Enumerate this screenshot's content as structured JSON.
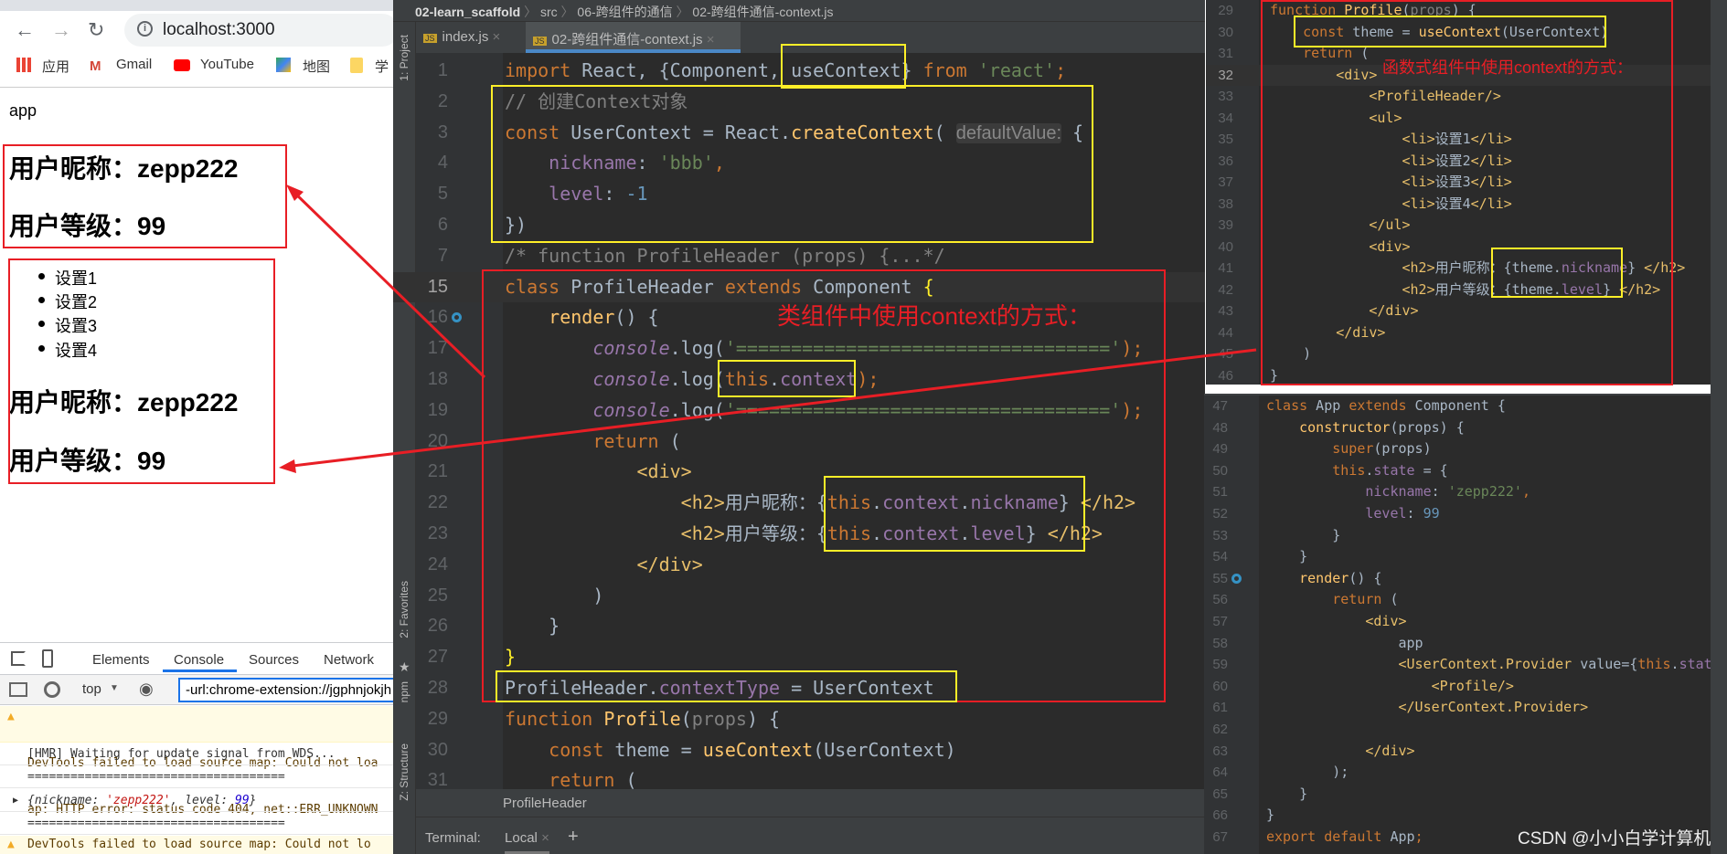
{
  "browser": {
    "address": "localhost:3000",
    "bookmarks": [
      "应用",
      "Gmail",
      "YouTube",
      "地图",
      "学"
    ],
    "page": {
      "app_text": "app",
      "top_h2": [
        "用户昵称：zepp222",
        "用户等级：99"
      ],
      "list": [
        "设置1",
        "设置2",
        "设置3",
        "设置4"
      ],
      "bottom_h2": [
        "用户昵称：zepp222",
        "用户等级：99"
      ]
    }
  },
  "devtools": {
    "tabs": [
      "Elements",
      "Console",
      "Sources",
      "Network"
    ],
    "active_tab": "Console",
    "context": "top",
    "filter": "-url:chrome-extension://jgphnjokjh",
    "messages": {
      "warn1_line1": "DevTools failed to load source map: Could not loa",
      "warn1_line2": "ap: HTTP error: status code 404, net::ERR_UNKNOWN",
      "hmr": "[HMR] Waiting for update signal from WDS...",
      "sep1": "====================================",
      "obj_open": "{nickname: ",
      "obj_nick": "'zepp222'",
      "obj_mid": ", level: ",
      "obj_level": "99",
      "obj_close": "}",
      "sep2": "====================================",
      "warn2": "DevTools failed to load source map: Could not lo"
    }
  },
  "ide": {
    "breadcrumb": [
      "02-learn_scaffold",
      "src",
      "06-跨组件的通信",
      "02-跨组件通信-context.js"
    ],
    "tabs": [
      "index.js",
      "02-跨组件通信-context.js"
    ],
    "tool_windows": [
      "1: Project",
      "2: Favorites",
      "npm",
      "Z: Structure"
    ],
    "structure_crumb": "ProfileHeader",
    "terminal_label": "Terminal:",
    "terminal_tab": "Local",
    "annotation_class": "类组件中使用context的方式：",
    "annotation_function": "函数式组件中使用context的方式：",
    "watermark": "CSDN @小小白学计算机",
    "colors": {
      "keyword": "#cc7832",
      "string": "#6a8759",
      "property": "#9876aa",
      "function": "#ffc66d",
      "annotation": "#e81e25",
      "highlight_box": "#ffef28"
    }
  },
  "editor": {
    "lines": [
      {
        "n": "1",
        "t": [
          [
            "import",
            "kw"
          ],
          [
            " React, {Component, useContext} ",
            "p"
          ],
          [
            "from",
            "kw"
          ],
          [
            " ",
            "p"
          ],
          [
            "'react'",
            "str"
          ],
          [
            ";",
            "kw"
          ]
        ]
      },
      {
        "n": "2",
        "t": [
          [
            "// 创建Context对象",
            "cm"
          ]
        ]
      },
      {
        "n": "3",
        "t": [
          [
            "const",
            "kw"
          ],
          [
            " UserContext = React.",
            "p"
          ],
          [
            "createContext",
            "fn"
          ],
          [
            "( ",
            "p"
          ],
          [
            "defaultValue:",
            "hint"
          ],
          [
            " {",
            "p"
          ]
        ]
      },
      {
        "n": "4",
        "t": [
          [
            "    ",
            "p"
          ],
          [
            "nickname",
            "prop"
          ],
          [
            ": ",
            "p"
          ],
          [
            "'bbb'",
            "str"
          ],
          [
            ",",
            "kw"
          ]
        ]
      },
      {
        "n": "5",
        "t": [
          [
            "    ",
            "p"
          ],
          [
            "level",
            "prop"
          ],
          [
            ": ",
            "p"
          ],
          [
            "-1",
            "num"
          ]
        ]
      },
      {
        "n": "6",
        "t": [
          [
            "})",
            "p"
          ]
        ]
      },
      {
        "n": "7",
        "t": [
          [
            "/* function ProfileHeader (props) {...*/",
            "cm"
          ]
        ]
      },
      {
        "n": "15",
        "t": [
          [
            "class",
            "kw"
          ],
          [
            " ProfileHeader ",
            "p"
          ],
          [
            "extends",
            "kw"
          ],
          [
            " Component ",
            "p"
          ],
          [
            "{",
            "yel"
          ]
        ]
      },
      {
        "n": "16",
        "t": [
          [
            "    ",
            "p"
          ],
          [
            "render",
            "fn"
          ],
          [
            "() {",
            "p"
          ]
        ]
      },
      {
        "n": "17",
        "t": [
          [
            "        ",
            "p"
          ],
          [
            "console",
            "it"
          ],
          [
            ".log(",
            "p"
          ],
          [
            "'=================================='",
            "str"
          ],
          [
            ");",
            "kw"
          ]
        ]
      },
      {
        "n": "18",
        "t": [
          [
            "        ",
            "p"
          ],
          [
            "console",
            "it"
          ],
          [
            ".log(",
            "p"
          ],
          [
            "this",
            "kw"
          ],
          [
            ".",
            "p"
          ],
          [
            "context",
            "prop"
          ],
          [
            ");",
            "kw"
          ]
        ]
      },
      {
        "n": "19",
        "t": [
          [
            "        ",
            "p"
          ],
          [
            "console",
            "it"
          ],
          [
            ".log(",
            "p"
          ],
          [
            "'=================================='",
            "str"
          ],
          [
            ");",
            "kw"
          ]
        ]
      },
      {
        "n": "20",
        "t": [
          [
            "        ",
            "p"
          ],
          [
            "return",
            "kw"
          ],
          [
            " (",
            "p"
          ]
        ]
      },
      {
        "n": "21",
        "t": [
          [
            "            ",
            "p"
          ],
          [
            "<div>",
            "tag"
          ]
        ]
      },
      {
        "n": "22",
        "t": [
          [
            "                ",
            "p"
          ],
          [
            "<h2>",
            "tag"
          ],
          [
            "用户昵称：{",
            "p"
          ],
          [
            "this",
            "kw"
          ],
          [
            ".",
            "p"
          ],
          [
            "context",
            "prop"
          ],
          [
            ".",
            "p"
          ],
          [
            "nickname",
            "prop"
          ],
          [
            "} ",
            "p"
          ],
          [
            "</h2>",
            "tag"
          ]
        ]
      },
      {
        "n": "23",
        "t": [
          [
            "                ",
            "p"
          ],
          [
            "<h2>",
            "tag"
          ],
          [
            "用户等级：{",
            "p"
          ],
          [
            "this",
            "kw"
          ],
          [
            ".",
            "p"
          ],
          [
            "context",
            "prop"
          ],
          [
            ".",
            "p"
          ],
          [
            "level",
            "prop"
          ],
          [
            "} ",
            "p"
          ],
          [
            "</h2>",
            "tag"
          ]
        ]
      },
      {
        "n": "24",
        "t": [
          [
            "            ",
            "p"
          ],
          [
            "</div>",
            "tag"
          ]
        ]
      },
      {
        "n": "25",
        "t": [
          [
            "        )",
            "p"
          ]
        ]
      },
      {
        "n": "26",
        "t": [
          [
            "    }",
            "p"
          ]
        ]
      },
      {
        "n": "27",
        "t": [
          [
            "}",
            "yel"
          ]
        ]
      },
      {
        "n": "28",
        "t": [
          [
            "ProfileHeader.",
            "p"
          ],
          [
            "contextType",
            "prop"
          ],
          [
            " = UserContext",
            "p"
          ]
        ]
      },
      {
        "n": "29",
        "t": [
          [
            "function",
            "kw"
          ],
          [
            " ",
            "p"
          ],
          [
            "Profile",
            "fn"
          ],
          [
            "(",
            "p"
          ],
          [
            "props",
            "cm"
          ],
          [
            ") {",
            "p"
          ]
        ]
      },
      {
        "n": "30",
        "t": [
          [
            "    ",
            "p"
          ],
          [
            "const",
            "kw"
          ],
          [
            " theme = ",
            "p"
          ],
          [
            "useContext",
            "fn"
          ],
          [
            "(UserContext)",
            "p"
          ]
        ]
      },
      {
        "n": "31",
        "t": [
          [
            "    ",
            "p"
          ],
          [
            "return",
            "kw"
          ],
          [
            " (",
            "p"
          ]
        ]
      }
    ]
  },
  "panel_function": {
    "lines": [
      {
        "n": "29",
        "t": [
          [
            "function",
            "kw"
          ],
          [
            " ",
            "p"
          ],
          [
            "Profile",
            "fn"
          ],
          [
            "(",
            "p"
          ],
          [
            "props",
            "cm"
          ],
          [
            ") {",
            "p"
          ]
        ]
      },
      {
        "n": "30",
        "t": [
          [
            "    ",
            "p"
          ],
          [
            "const",
            "kw"
          ],
          [
            " theme = ",
            "p"
          ],
          [
            "useContext",
            "fn"
          ],
          [
            "(UserContext)",
            "p"
          ]
        ]
      },
      {
        "n": "31",
        "t": [
          [
            "    ",
            "p"
          ],
          [
            "return",
            "kw"
          ],
          [
            " (",
            "p"
          ]
        ]
      },
      {
        "n": "32",
        "t": [
          [
            "        ",
            "p"
          ],
          [
            "<div>",
            "tag"
          ]
        ]
      },
      {
        "n": "33",
        "t": [
          [
            "            ",
            "p"
          ],
          [
            "<ProfileHeader/>",
            "tag"
          ]
        ]
      },
      {
        "n": "34",
        "t": [
          [
            "            ",
            "p"
          ],
          [
            "<ul>",
            "tag"
          ]
        ]
      },
      {
        "n": "35",
        "t": [
          [
            "                ",
            "p"
          ],
          [
            "<li>",
            "tag"
          ],
          [
            "设置1",
            "p"
          ],
          [
            "</li>",
            "tag"
          ]
        ]
      },
      {
        "n": "36",
        "t": [
          [
            "                ",
            "p"
          ],
          [
            "<li>",
            "tag"
          ],
          [
            "设置2",
            "p"
          ],
          [
            "</li>",
            "tag"
          ]
        ]
      },
      {
        "n": "37",
        "t": [
          [
            "                ",
            "p"
          ],
          [
            "<li>",
            "tag"
          ],
          [
            "设置3",
            "p"
          ],
          [
            "</li>",
            "tag"
          ]
        ]
      },
      {
        "n": "38",
        "t": [
          [
            "                ",
            "p"
          ],
          [
            "<li>",
            "tag"
          ],
          [
            "设置4",
            "p"
          ],
          [
            "</li>",
            "tag"
          ]
        ]
      },
      {
        "n": "39",
        "t": [
          [
            "            ",
            "p"
          ],
          [
            "</ul>",
            "tag"
          ]
        ]
      },
      {
        "n": "40",
        "t": [
          [
            "            ",
            "p"
          ],
          [
            "<div>",
            "tag"
          ]
        ]
      },
      {
        "n": "41",
        "t": [
          [
            "                ",
            "p"
          ],
          [
            "<h2>",
            "tag"
          ],
          [
            "用户昵称：{theme.",
            "p"
          ],
          [
            "nickname",
            "prop"
          ],
          [
            "} ",
            "p"
          ],
          [
            "</h2>",
            "tag"
          ]
        ]
      },
      {
        "n": "42",
        "t": [
          [
            "                ",
            "p"
          ],
          [
            "<h2>",
            "tag"
          ],
          [
            "用户等级：{theme.",
            "p"
          ],
          [
            "level",
            "prop"
          ],
          [
            "} ",
            "p"
          ],
          [
            "</h2>",
            "tag"
          ]
        ]
      },
      {
        "n": "43",
        "t": [
          [
            "            ",
            "p"
          ],
          [
            "</div>",
            "tag"
          ]
        ]
      },
      {
        "n": "44",
        "t": [
          [
            "        ",
            "p"
          ],
          [
            "</div>",
            "tag"
          ]
        ]
      },
      {
        "n": "45",
        "t": [
          [
            "    )",
            "p"
          ]
        ]
      },
      {
        "n": "46",
        "t": [
          [
            "}",
            "p"
          ]
        ]
      }
    ]
  },
  "panel_app": {
    "lines": [
      {
        "n": "47",
        "t": [
          [
            "class",
            "kw"
          ],
          [
            " App ",
            "p"
          ],
          [
            "extends",
            "kw"
          ],
          [
            " Component {",
            "p"
          ]
        ]
      },
      {
        "n": "48",
        "t": [
          [
            "    ",
            "p"
          ],
          [
            "constructor",
            "fn"
          ],
          [
            "(props) {",
            "p"
          ]
        ]
      },
      {
        "n": "49",
        "t": [
          [
            "        ",
            "p"
          ],
          [
            "super",
            "kw"
          ],
          [
            "(props)",
            "p"
          ]
        ]
      },
      {
        "n": "50",
        "t": [
          [
            "        ",
            "p"
          ],
          [
            "this",
            "kw"
          ],
          [
            ".",
            "p"
          ],
          [
            "state",
            "prop"
          ],
          [
            " = {",
            "p"
          ]
        ]
      },
      {
        "n": "51",
        "t": [
          [
            "            ",
            "p"
          ],
          [
            "nickname",
            "prop"
          ],
          [
            ": ",
            "p"
          ],
          [
            "'zepp222'",
            "str"
          ],
          [
            ",",
            "kw"
          ]
        ]
      },
      {
        "n": "52",
        "t": [
          [
            "            ",
            "p"
          ],
          [
            "level",
            "prop"
          ],
          [
            ": ",
            "p"
          ],
          [
            "99",
            "num"
          ]
        ]
      },
      {
        "n": "53",
        "t": [
          [
            "        }",
            "p"
          ]
        ]
      },
      {
        "n": "54",
        "t": [
          [
            "    }",
            "p"
          ]
        ]
      },
      {
        "n": "55",
        "t": [
          [
            "    ",
            "p"
          ],
          [
            "render",
            "fn"
          ],
          [
            "() {",
            "p"
          ]
        ]
      },
      {
        "n": "56",
        "t": [
          [
            "        ",
            "p"
          ],
          [
            "return",
            "kw"
          ],
          [
            " (",
            "p"
          ]
        ]
      },
      {
        "n": "57",
        "t": [
          [
            "            ",
            "p"
          ],
          [
            "<div>",
            "tag"
          ]
        ]
      },
      {
        "n": "58",
        "t": [
          [
            "                app",
            "p"
          ]
        ]
      },
      {
        "n": "59",
        "t": [
          [
            "                ",
            "p"
          ],
          [
            "<UserContext.Provider ",
            "tag"
          ],
          [
            "value={",
            "p"
          ],
          [
            "this",
            "kw"
          ],
          [
            ".",
            "p"
          ],
          [
            "state",
            "prop"
          ],
          [
            "}",
            "p"
          ],
          [
            ">",
            "tag"
          ]
        ]
      },
      {
        "n": "60",
        "t": [
          [
            "                    ",
            "p"
          ],
          [
            "<Profile/>",
            "tag"
          ]
        ]
      },
      {
        "n": "61",
        "t": [
          [
            "                ",
            "p"
          ],
          [
            "</UserContext.Provider>",
            "tag"
          ]
        ]
      },
      {
        "n": "62",
        "t": [
          [
            "",
            "p"
          ]
        ]
      },
      {
        "n": "63",
        "t": [
          [
            "            ",
            "p"
          ],
          [
            "</div>",
            "tag"
          ]
        ]
      },
      {
        "n": "64",
        "t": [
          [
            "        );",
            "p"
          ]
        ]
      },
      {
        "n": "65",
        "t": [
          [
            "    }",
            "p"
          ]
        ]
      },
      {
        "n": "66",
        "t": [
          [
            "}",
            "p"
          ]
        ]
      },
      {
        "n": "67",
        "t": [
          [
            "export default",
            "kw"
          ],
          [
            " App",
            "p"
          ],
          [
            ";",
            "kw"
          ]
        ]
      }
    ]
  }
}
